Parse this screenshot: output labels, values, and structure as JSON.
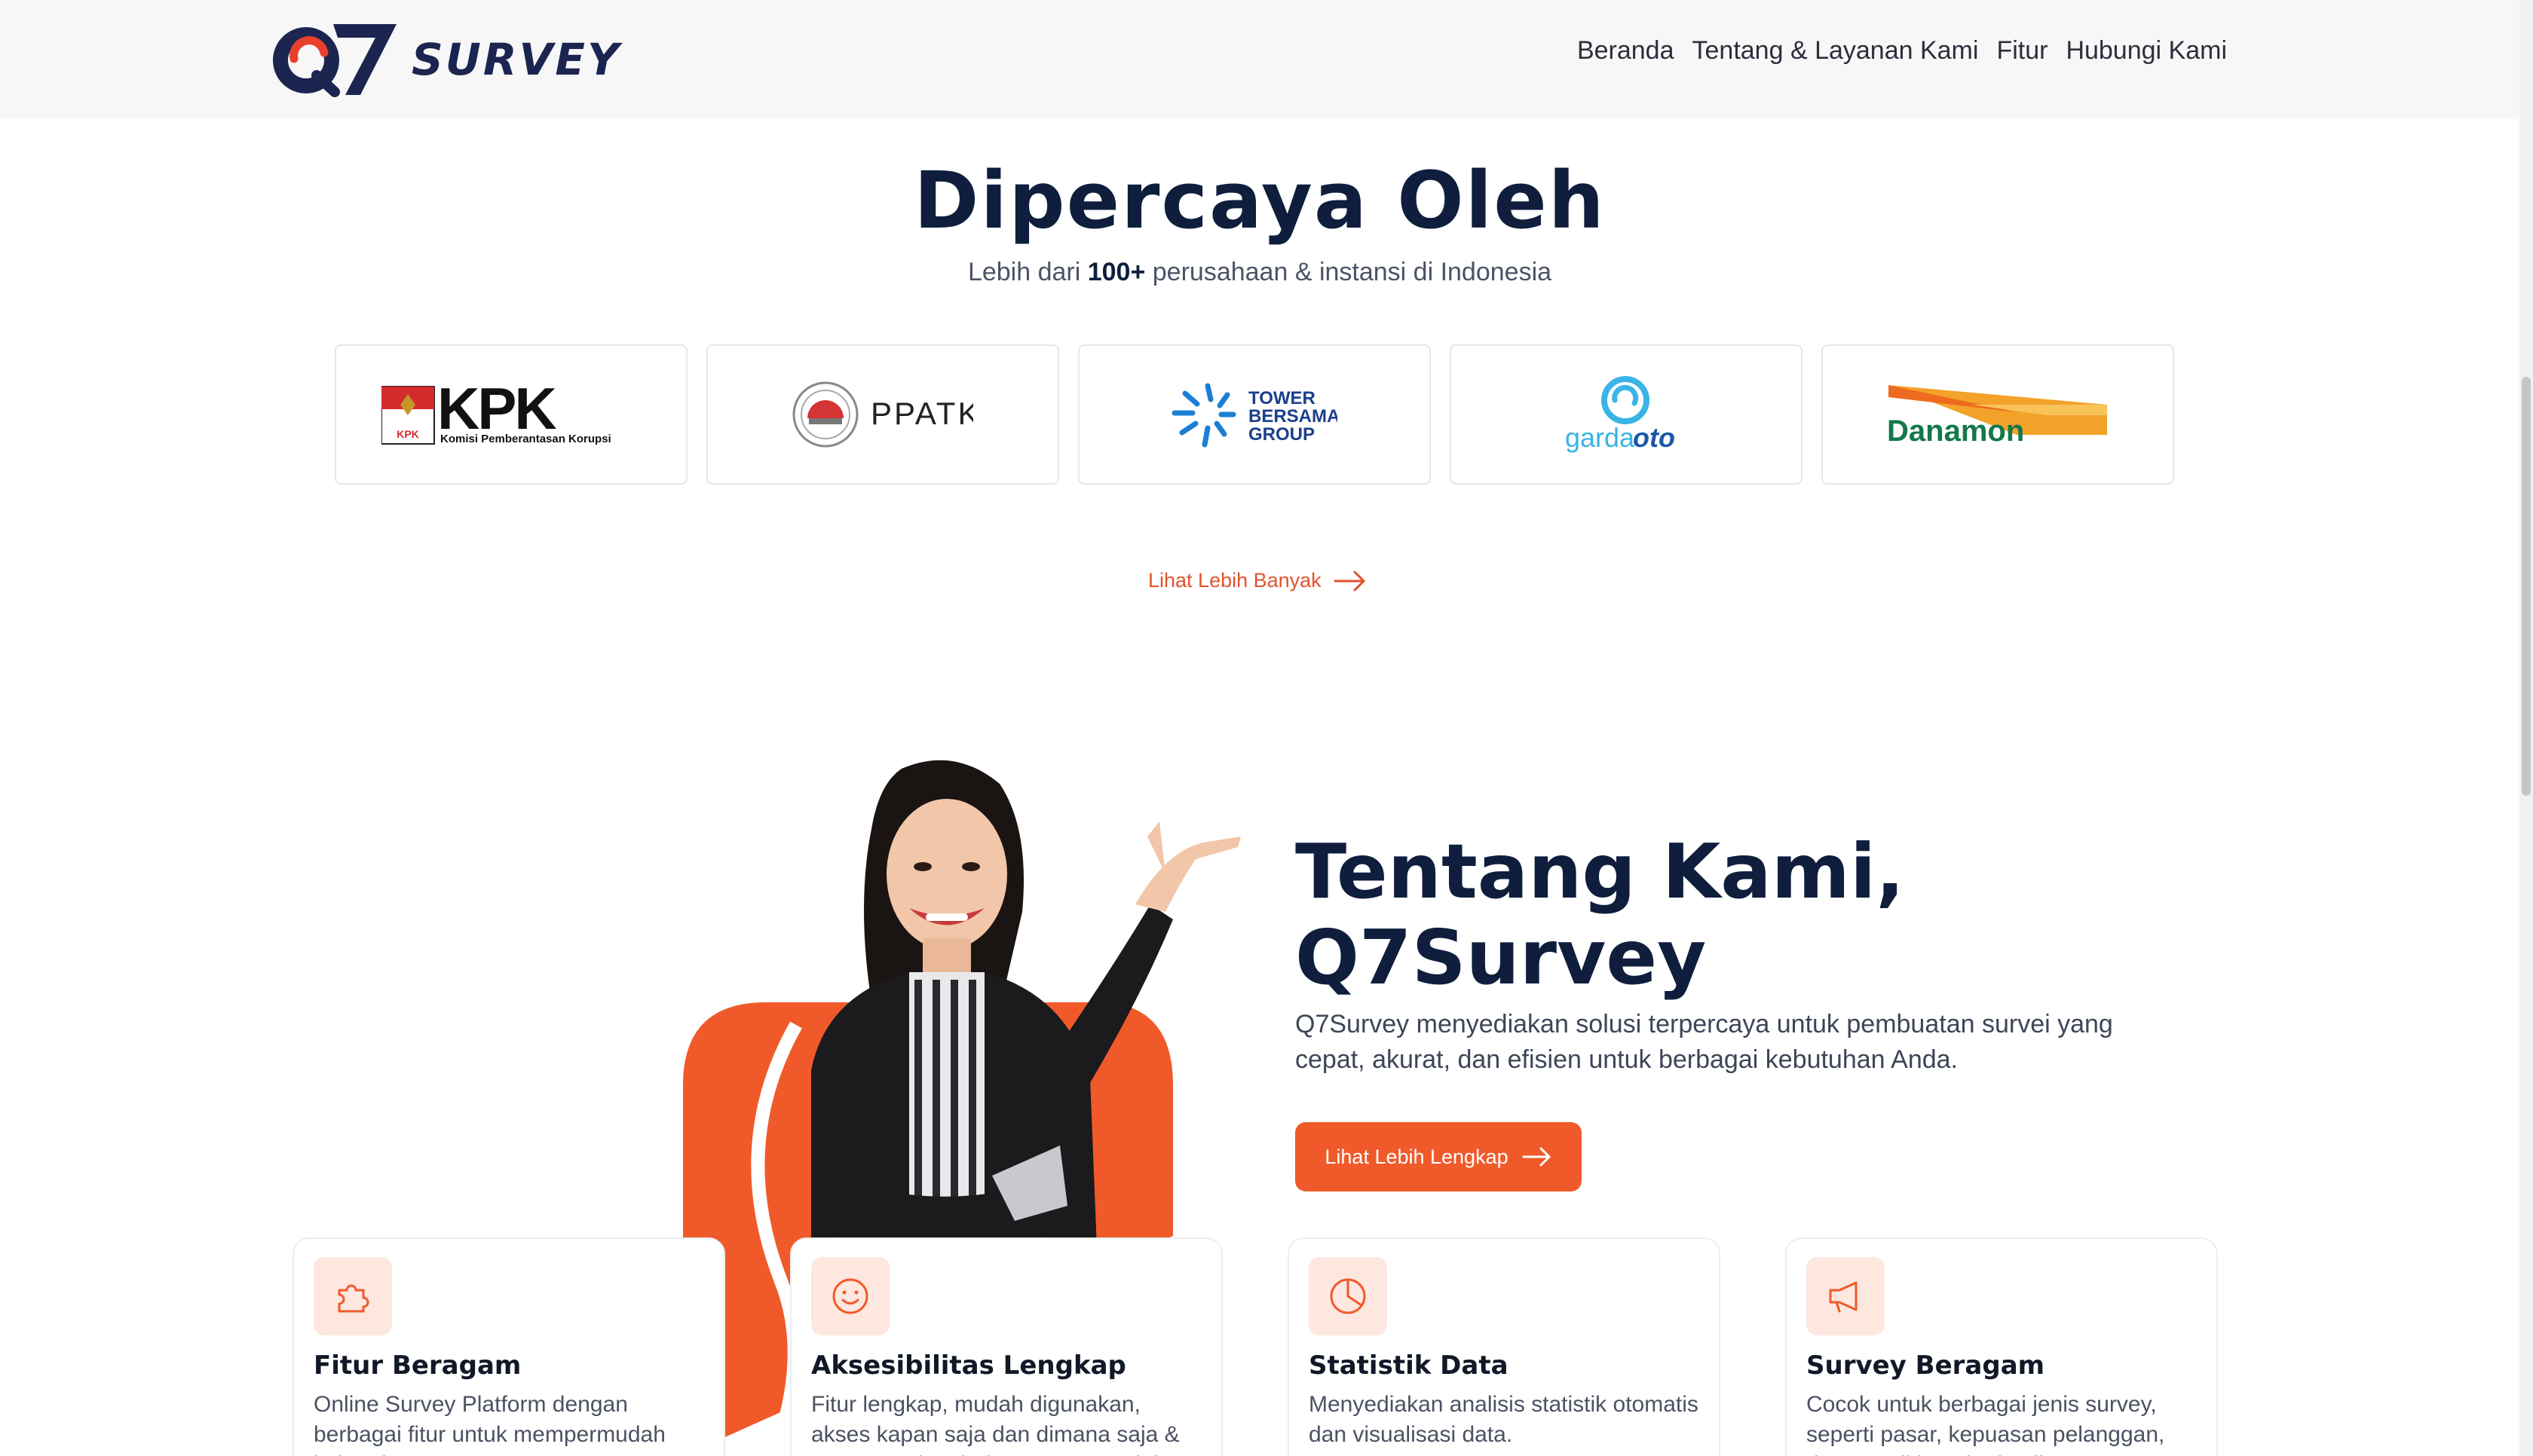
{
  "header": {
    "brand": "SURVEY",
    "nav": [
      "Beranda",
      "Tentang & Layanan Kami",
      "Fitur",
      "Hubungi Kami"
    ]
  },
  "trusted": {
    "title": "Dipercaya Oleh",
    "subtitle_pre": "Lebih dari ",
    "subtitle_bold": "100+",
    "subtitle_post": " perusahaan & instansi di Indonesia",
    "logos": {
      "kpk": {
        "name": "KPK",
        "caption": "Komisi Pemberantasan Korupsi",
        "badge": "KPK"
      },
      "ppatk": {
        "name": "PPATK"
      },
      "tower": {
        "line1": "TOWER",
        "line2": "BERSAMA",
        "line3": "GROUP"
      },
      "garda": {
        "part1": "garda",
        "part2": "oto"
      },
      "danamon": {
        "name": "Danamon"
      }
    },
    "more_link": "Lihat Lebih Banyak"
  },
  "about": {
    "title_line1": "Tentang Kami,",
    "title_line2": "Q7Survey",
    "description": "Q7Survey menyediakan solusi terpercaya untuk pembuatan survei yang cepat, akurat, dan efisien untuk berbagai kebutuhan Anda.",
    "button": "Lihat Lebih Lengkap"
  },
  "features": [
    {
      "title": "Fitur Beragam",
      "desc": "Online Survey Platform dengan berbagai fitur untuk mempermudah kebutuhan",
      "icon": "puzzle-icon"
    },
    {
      "title": "Aksesibilitas Lengkap",
      "desc": "Fitur lengkap, mudah digunakan, akses kapan saja dan dimana saja & menggunakan bahasa yang mudah",
      "icon": "smile-icon"
    },
    {
      "title": "Statistik Data",
      "desc": "Menyediakan analisis statistik otomatis dan visualisasi data.",
      "icon": "pie-chart-icon"
    },
    {
      "title": "Survey Beragam",
      "desc": "Cocok untuk berbagai jenis survey, seperti pasar, kepuasan pelanggan, dan penelitian akademik",
      "icon": "megaphone-icon"
    }
  ],
  "colors": {
    "accent": "#f05a2a",
    "navy": "#0f1e3d",
    "icon_bg": "#fde7df"
  }
}
